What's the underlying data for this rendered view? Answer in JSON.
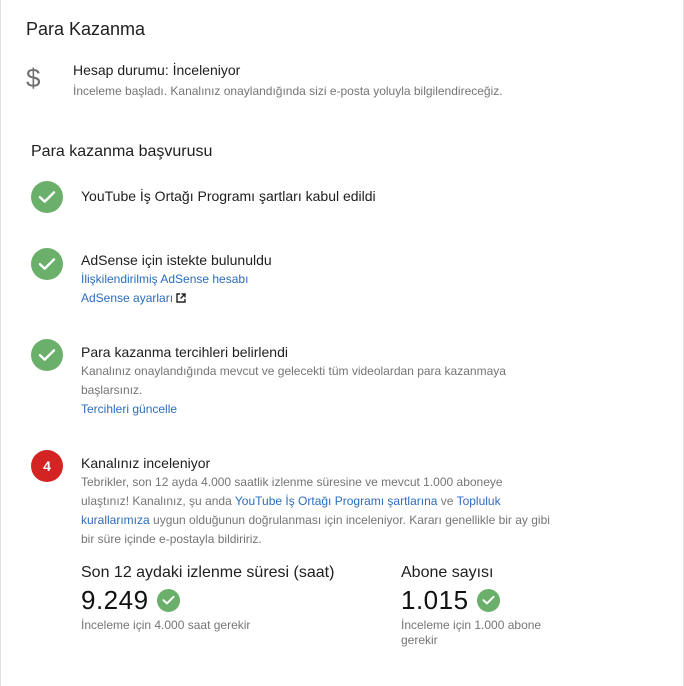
{
  "header": {
    "title": "Para Kazanma"
  },
  "account_status": {
    "icon": "dollar-icon",
    "title": "Hesap durumu: İnceleniyor",
    "description": "İnceleme başladı. Kanalınız onaylandığında sizi e-posta yoluyla bilgilendireceğiz."
  },
  "application": {
    "section_title": "Para kazanma başvurusu",
    "steps": [
      {
        "status": "done",
        "title": "YouTube İş Ortağı Programı şartları kabul edildi"
      },
      {
        "status": "done",
        "title": "AdSense için istekte bulunuldu",
        "link1": "İlişkilendirilmiş AdSense hesabı",
        "link2": "AdSense ayarları"
      },
      {
        "status": "done",
        "title": "Para kazanma tercihleri belirlendi",
        "text_line1": "Kanalınız onaylandığında mevcut ve gelecekti tüm videolardan para kazanmaya",
        "text_line2": "başlarsınız.",
        "link": "Tercihleri güncelle"
      },
      {
        "status": "in_progress",
        "number": "4",
        "title": "Kanalınız inceleniyor",
        "text_a": "Tebrikler, son 12 ayda 4.000 saatlik izlenme süresine ve mevcut 1.000 aboneye ulaştınız! Kanalınız, şu anda ",
        "link_a": "YouTube İş Ortağı Programı şartlarına",
        "text_b": " ve ",
        "link_b": "Topluluk kurallarımıza",
        "text_c": " uygun olduğunun doğrulanması için inceleniyor. Kararı genellikle bir ay gibi bir süre içinde e-postayla bildiririz."
      }
    ]
  },
  "stats": {
    "watch_time": {
      "label": "Son 12 aydaki izlenme süresi (saat)",
      "value": "9.249",
      "note": "İnceleme için 4.000 saat gerekir"
    },
    "subscribers": {
      "label": "Abone sayısı",
      "value": "1.015",
      "note_line1": "İnceleme için 1.000 abone",
      "note_line2": "gerekir"
    }
  },
  "colors": {
    "check_green": "#6ab06b",
    "step_red": "#d32323",
    "link_blue": "#2b6dbd"
  }
}
